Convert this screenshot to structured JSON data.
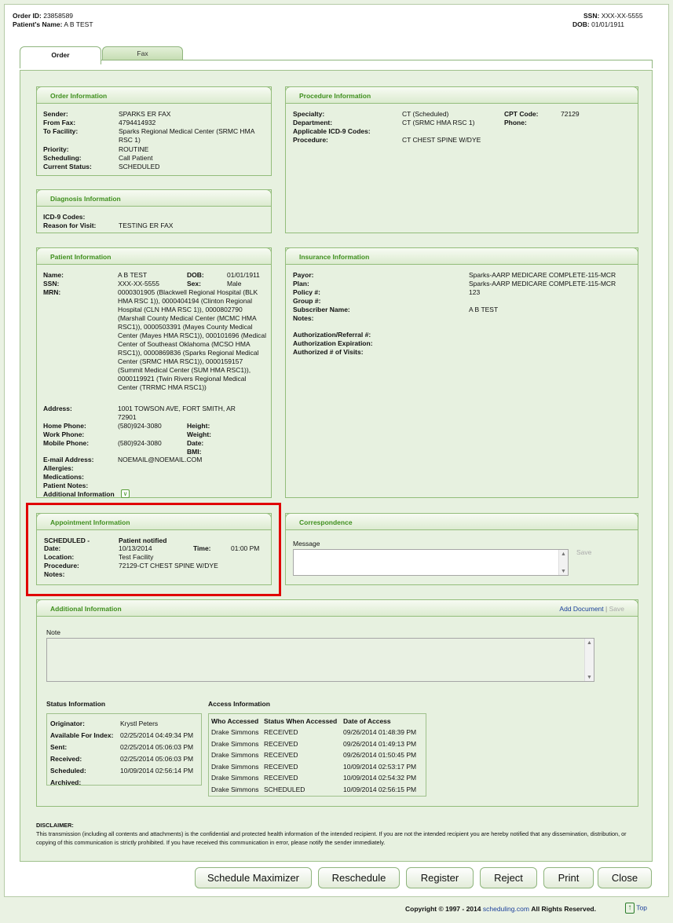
{
  "header": {
    "order_id_label": "Order ID:",
    "order_id": "23858589",
    "patient_name_label": "Patient's Name:",
    "patient_name": "A B TEST",
    "ssn_label": "SSN:",
    "ssn": "XXX-XX-5555",
    "dob_label": "DOB:",
    "dob": "01/01/1911"
  },
  "tabs": [
    {
      "label": "Order",
      "active": true
    },
    {
      "label": "Fax",
      "active": false
    }
  ],
  "order_info": {
    "title": "Order Information",
    "sender_label": "Sender:",
    "sender": "SPARKS ER FAX",
    "from_fax_label": "From Fax:",
    "from_fax": "4794414932",
    "to_facility_label": "To Facility:",
    "to_facility": "Sparks Regional Medical Center (SRMC HMA RSC 1)",
    "priority_label": "Priority:",
    "priority": "ROUTINE",
    "scheduling_label": "Scheduling:",
    "scheduling": "Call Patient",
    "status_label": "Current Status:",
    "status": "SCHEDULED"
  },
  "procedure_info": {
    "title": "Procedure Information",
    "specialty_label": "Specialty:",
    "specialty": "CT (Scheduled)",
    "department_label": "Department:",
    "department": "CT (SRMC HMA RSC 1)",
    "icd9_label": "Applicable ICD-9 Codes:",
    "procedure_label": "Procedure:",
    "procedure": "CT CHEST SPINE W/DYE",
    "cpt_label": "CPT Code:",
    "cpt": "72129",
    "phone_label": "Phone:"
  },
  "diagnosis_info": {
    "title": "Diagnosis Information",
    "icd9_label": "ICD-9 Codes:",
    "reason_label": "Reason for Visit:",
    "reason": "TESTING ER FAX"
  },
  "patient_info": {
    "title": "Patient Information",
    "name_label": "Name:",
    "name": "A B TEST",
    "dob_label": "DOB:",
    "dob": "01/01/1911",
    "ssn_label": "SSN:",
    "ssn": "XXX-XX-5555",
    "sex_label": "Sex:",
    "sex": "Male",
    "mrn_label": "MRN:",
    "mrn": "0000301905 (Blackwell Regional Hospital (BLK HMA RSC 1)), 0000404194 (Clinton Regional Hospital (CLN HMA RSC 1)), 0000802790 (Marshall County Medical Center (MCMC HMA RSC1)), 0000503391 (Mayes County Medical Center (Mayes HMA RSC1)), 000101696 (Medical Center of Southeast Oklahoma (MCSO HMA RSC1)), 0000869836 (Sparks Regional Medical Center (SRMC HMA RSC1)), 0000159157 (Summit Medical Center (SUM HMA RSC1)), 0000119921 (Twin Rivers Regional Medical Center (TRRMC HMA RSC1))",
    "address_label": "Address:",
    "address": "1001 TOWSON AVE, FORT SMITH, AR 72901",
    "home_phone_label": "Home Phone:",
    "home_phone": "(580)924-3080",
    "work_phone_label": "Work Phone:",
    "mobile_phone_label": "Mobile Phone:",
    "mobile_phone": "(580)924-3080",
    "height_label": "Height:",
    "weight_label": "Weight:",
    "date_label": "Date:",
    "bmi_label": "BMI:",
    "email_label": "E-mail Address:",
    "email": "NOEMAIL@NOEMAIL.COM",
    "allergies_label": "Allergies:",
    "medications_label": "Medications:",
    "notes_label": "Patient Notes:",
    "additional_label": "Additional Information"
  },
  "insurance_info": {
    "title": "Insurance Information",
    "payor_label": "Payor:",
    "payor": "Sparks-AARP MEDICARE COMPLETE-115-MCR",
    "plan_label": "Plan:",
    "plan": "Sparks-AARP MEDICARE COMPLETE-115-MCR",
    "policy_label": "Policy #:",
    "policy": "123",
    "group_label": "Group #:",
    "subscriber_label": "Subscriber Name:",
    "subscriber": "A B TEST",
    "notes_label": "Notes:",
    "auth_ref_label": "Authorization/Referral #:",
    "auth_exp_label": "Authorization Expiration:",
    "auth_visits_label": "Authorized # of Visits:"
  },
  "appointment_info": {
    "title": "Appointment Information",
    "status_label": "SCHEDULED -",
    "status_value": "Patient notified",
    "date_label": "Date:",
    "date": "10/13/2014",
    "time_label": "Time:",
    "time": "01:00 PM",
    "location_label": "Location:",
    "location": "Test Facility",
    "procedure_label": "Procedure:",
    "procedure": "72129-CT CHEST SPINE W/DYE",
    "notes_label": "Notes:"
  },
  "correspondence": {
    "title": "Correspondence",
    "message_label": "Message",
    "message_value": "",
    "save_label": "Save"
  },
  "additional_info": {
    "title": "Additional Information",
    "add_document": "Add Document",
    "separator": "|",
    "save_label": "Save",
    "note_label": "Note",
    "note_value": "",
    "status_title": "Status Information",
    "access_title": "Access Information",
    "status_rows": [
      {
        "label": "Originator:",
        "value": "Krystl Peters"
      },
      {
        "label": "Available For Index:",
        "value": "02/25/2014 04:49:34 PM"
      },
      {
        "label": "Sent:",
        "value": "02/25/2014 05:06:03 PM"
      },
      {
        "label": "Received:",
        "value": "02/25/2014 05:06:03 PM"
      },
      {
        "label": "Scheduled:",
        "value": "10/09/2014 02:56:14 PM"
      },
      {
        "label": "Archived:",
        "value": ""
      }
    ],
    "access_headers": [
      "Who Accessed",
      "Status When Accessed",
      "Date of Access"
    ],
    "access_rows": [
      {
        "who": "Drake Simmons",
        "status": "RECEIVED",
        "date": "09/26/2014 01:48:39 PM"
      },
      {
        "who": "Drake Simmons",
        "status": "RECEIVED",
        "date": "09/26/2014 01:49:13 PM"
      },
      {
        "who": "Drake Simmons",
        "status": "RECEIVED",
        "date": "09/26/2014 01:50:45 PM"
      },
      {
        "who": "Drake Simmons",
        "status": "RECEIVED",
        "date": "10/09/2014 02:53:17 PM"
      },
      {
        "who": "Drake Simmons",
        "status": "RECEIVED",
        "date": "10/09/2014 02:54:32 PM"
      },
      {
        "who": "Drake Simmons",
        "status": "SCHEDULED",
        "date": "10/09/2014 02:56:15 PM"
      }
    ]
  },
  "disclaimer": {
    "title": "DISCLAIMER:",
    "text": "This transmission (including all contents and attachments) is the confidential and protected health information of the intended recipient. If you are not the intended recipient you are hereby notified that any dissemination, distribution, or copying of this communication is strictly prohibited. If you have received this communication in error, please notify the sender immediately."
  },
  "buttons": {
    "schedule_maximizer": "Schedule Maximizer",
    "reschedule": "Reschedule",
    "register": "Register",
    "reject": "Reject",
    "print": "Print",
    "close": "Close"
  },
  "footer": {
    "copyright": "Copyright © 1997 - 2014",
    "site": "scheduling.com",
    "rights": "All Rights Reserved.",
    "top": "Top"
  },
  "colors": {
    "panel_title": "#3f8f1e",
    "panel_bg": "#e7f1e0",
    "highlight_box": "#e00000",
    "link": "#1b3f9b"
  },
  "icons": [
    "expand-icon",
    "scroll-up-icon",
    "scroll-down-icon",
    "top-arrow-icon"
  ]
}
